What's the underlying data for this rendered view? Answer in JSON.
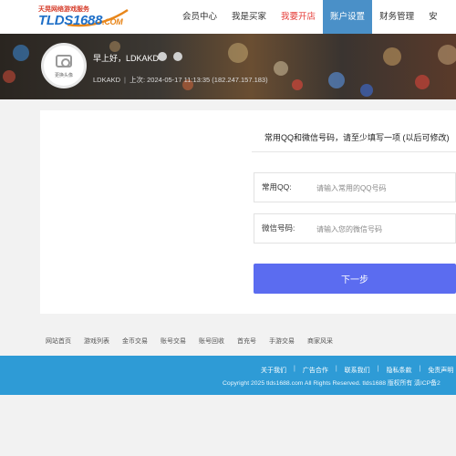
{
  "header": {
    "logo_tagline": "天晃网络游戏服务",
    "logo_brand": "TLDS1688",
    "logo_suffix": ".COM",
    "nav": [
      {
        "label": "会员中心"
      },
      {
        "label": "我是买家"
      },
      {
        "label": "我要开店"
      },
      {
        "label": "账户设置"
      },
      {
        "label": "财务管理"
      },
      {
        "label": "安"
      }
    ]
  },
  "profile": {
    "avatar_label": "更换头像",
    "greeting": "早上好，LDKAKD",
    "username": "LDKAKD",
    "last_login": "上次: 2024-05-17 11:13:35 (182.247.157.183)"
  },
  "form": {
    "title": "常用QQ和微信号码，请至少填写一项 (以后可修改)",
    "qq_label": "常用QQ:",
    "qq_placeholder": "请输入常用的QQ号码",
    "wechat_label": "微信号码:",
    "wechat_placeholder": "请输入您的微信号码",
    "next_label": "下一步"
  },
  "footer": {
    "links": [
      "网站首页",
      "游戏列表",
      "金币交易",
      "账号交易",
      "账号回收",
      "首充号",
      "手游交易",
      "商家风采"
    ],
    "nav": [
      "关于我们",
      "广告合作",
      "联系我们",
      "隐私条款",
      "免责声明"
    ],
    "copyright": "Copyright 2025 tlds1688.com All Rights Reserved. tlds1688   版权所有   滇ICP备2"
  },
  "colors": {
    "accent": "#5b6cf0",
    "nav_active": "#4a90c8",
    "footer_blue": "#2e9bd6",
    "highlight_red": "#e53935"
  }
}
